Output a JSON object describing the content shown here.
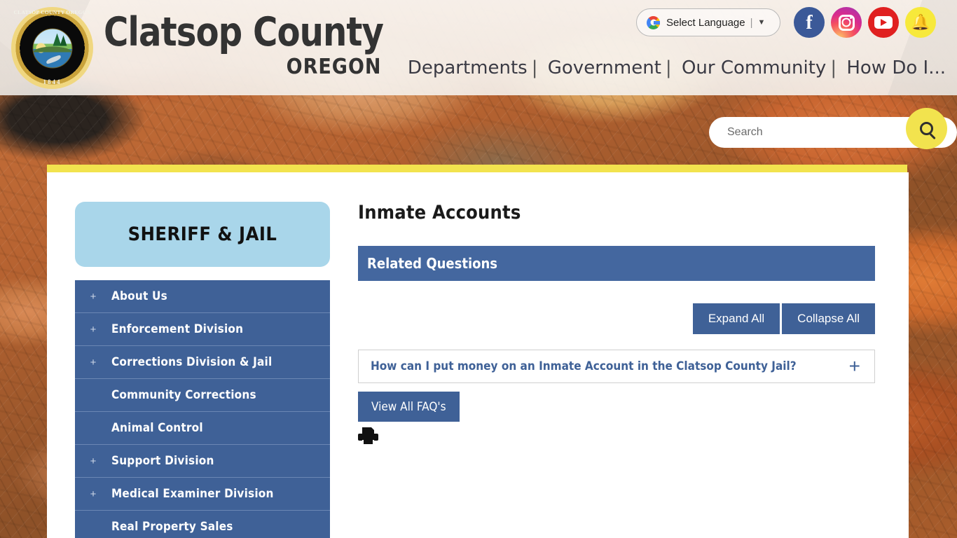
{
  "site": {
    "seal_text_top": "CLATSOP COUNTY OREGON",
    "seal_year": "1844",
    "title_line1": "Clatsop County",
    "title_line2": "OREGON"
  },
  "header": {
    "translate": {
      "label": "Select Language",
      "divider": "|",
      "caret": "▼"
    },
    "social": [
      {
        "name": "facebook",
        "glyph": "f",
        "color": "#3b5998"
      },
      {
        "name": "instagram",
        "glyph": "",
        "color": "#d92b8d"
      },
      {
        "name": "youtube",
        "glyph": "",
        "color": "#e02020"
      },
      {
        "name": "notify-me",
        "glyph": "🔔",
        "color": "#f7e93b"
      }
    ],
    "nav": [
      "Departments",
      "Government",
      "Our Community",
      "How Do I..."
    ],
    "nav_separator": "|"
  },
  "search": {
    "placeholder": "Search",
    "value": "",
    "button_icon": "search-icon",
    "accent": "#f2e34e"
  },
  "sidebar": {
    "department": "SHERIFF & JAIL",
    "items": [
      {
        "label": "About Us",
        "expandable": true,
        "marker": "+"
      },
      {
        "label": "Enforcement Division",
        "expandable": true,
        "marker": "+"
      },
      {
        "label": "Corrections Division & Jail",
        "expandable": true,
        "marker": "+"
      },
      {
        "label": "Community Corrections",
        "expandable": false,
        "marker": ""
      },
      {
        "label": "Animal Control",
        "expandable": false,
        "marker": ""
      },
      {
        "label": "Support Division",
        "expandable": true,
        "marker": "+"
      },
      {
        "label": "Medical Examiner Division",
        "expandable": true,
        "marker": "+"
      },
      {
        "label": "Real Property Sales",
        "expandable": false,
        "marker": ""
      }
    ]
  },
  "main": {
    "page_title": "Inmate Accounts",
    "related_questions_header": "Related Questions",
    "expand_all": "Expand All",
    "collapse_all": "Collapse All",
    "faqs": [
      {
        "question": "How can I put money on an Inmate Account in the Clatsop County Jail?",
        "toggle": "+"
      }
    ],
    "view_all_faqs": "View All FAQ's",
    "print_icon": "printer-icon"
  },
  "colors": {
    "brand_blue": "#3f6197",
    "header_blue": "#44679f",
    "accent_yellow": "#f2e34e",
    "dept_banner": "#a9d6ea"
  }
}
